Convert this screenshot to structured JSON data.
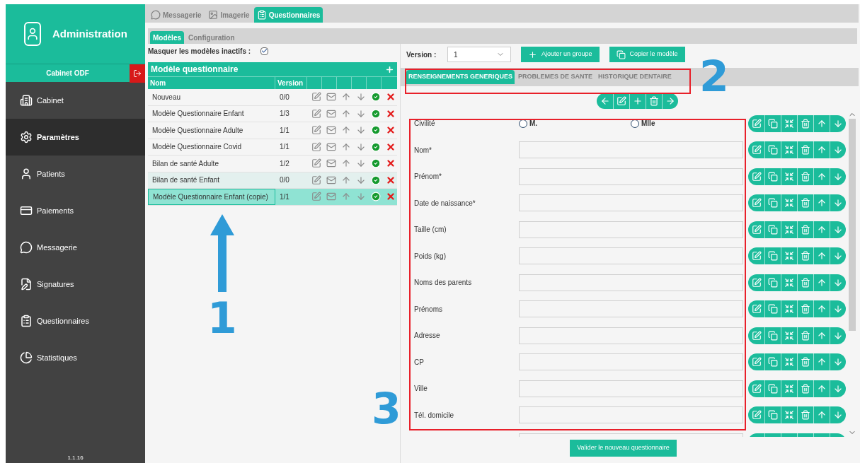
{
  "sidebar": {
    "title": "Administration",
    "cabinet": "Cabinet ODF",
    "items": [
      {
        "label": "Cabinet",
        "selected": false
      },
      {
        "label": "Paramètres",
        "selected": true
      },
      {
        "label": "Patients",
        "selected": false
      },
      {
        "label": "Paiements",
        "selected": false
      },
      {
        "label": "Messagerie",
        "selected": false
      },
      {
        "label": "Signatures",
        "selected": false
      },
      {
        "label": "Questionnaires",
        "selected": false
      },
      {
        "label": "Statistiques",
        "selected": false
      }
    ],
    "version": "1.1.16"
  },
  "top_tabs": [
    {
      "label": "Messagerie",
      "selected": false
    },
    {
      "label": "Imagerie",
      "selected": false
    },
    {
      "label": "Questionnaires",
      "selected": true
    }
  ],
  "sub_tabs": [
    {
      "label": "Modèles",
      "selected": true
    },
    {
      "label": "Configuration",
      "selected": false
    }
  ],
  "hide_inactive": {
    "label": "Masquer les modèles inactifs :",
    "checked": true
  },
  "models_table": {
    "title": "Modèle questionnaire",
    "columns": [
      "Nom",
      "Version"
    ],
    "rows": [
      {
        "name": "Nouveau",
        "version": "0/0",
        "highlighted": false,
        "selected": false
      },
      {
        "name": "Modèle Questionnaire Enfant",
        "version": "1/3",
        "highlighted": false,
        "selected": false
      },
      {
        "name": "Modèle Questionnaire Adulte",
        "version": "1/1",
        "highlighted": false,
        "selected": false
      },
      {
        "name": "Modèle Questionnaire Covid",
        "version": "1/1",
        "highlighted": false,
        "selected": false
      },
      {
        "name": "Bilan de santé Adulte",
        "version": "1/2",
        "highlighted": false,
        "selected": false
      },
      {
        "name": "Bilan de santé Enfant",
        "version": "0/0",
        "highlighted": true,
        "selected": false
      },
      {
        "name": "Modèle Questionnaire Enfant (copie)",
        "version": "1/1",
        "highlighted": false,
        "selected": true
      }
    ]
  },
  "version_select": {
    "label": "Version :",
    "value": "1"
  },
  "buttons": [
    "Ajouter un groupe",
    "Copier le modèle"
  ],
  "group_tabs": [
    {
      "label": "RENSEIGNEMENTS GENERIQUES",
      "selected": true
    },
    {
      "label": "PROBLEMES DE SANTE",
      "selected": false
    },
    {
      "label": "HISTORIQUE DENTAIRE",
      "selected": false
    }
  ],
  "form_rows": [
    {
      "kind": "radio",
      "label": "Civilité",
      "options": [
        {
          "label": "M.",
          "selected": false
        },
        {
          "label": "Mlle",
          "selected": false
        }
      ]
    },
    {
      "kind": "text",
      "label": "Nom*"
    },
    {
      "kind": "text",
      "label": "Prénom*"
    },
    {
      "kind": "text",
      "label": "Date de naissance*"
    },
    {
      "kind": "text",
      "label": "Taille (cm)"
    },
    {
      "kind": "text",
      "label": "Poids (kg)"
    },
    {
      "kind": "text",
      "label": "Noms des parents"
    },
    {
      "kind": "text",
      "label": "Prénoms"
    },
    {
      "kind": "text",
      "label": "Adresse"
    },
    {
      "kind": "text",
      "label": "CP"
    },
    {
      "kind": "text",
      "label": "Ville"
    },
    {
      "kind": "text",
      "label": "Tél. domicile"
    },
    {
      "kind": "text"
    }
  ],
  "submit": "Valider le nouveau questionnaire",
  "annotations": [
    "1",
    "2",
    "3"
  ]
}
